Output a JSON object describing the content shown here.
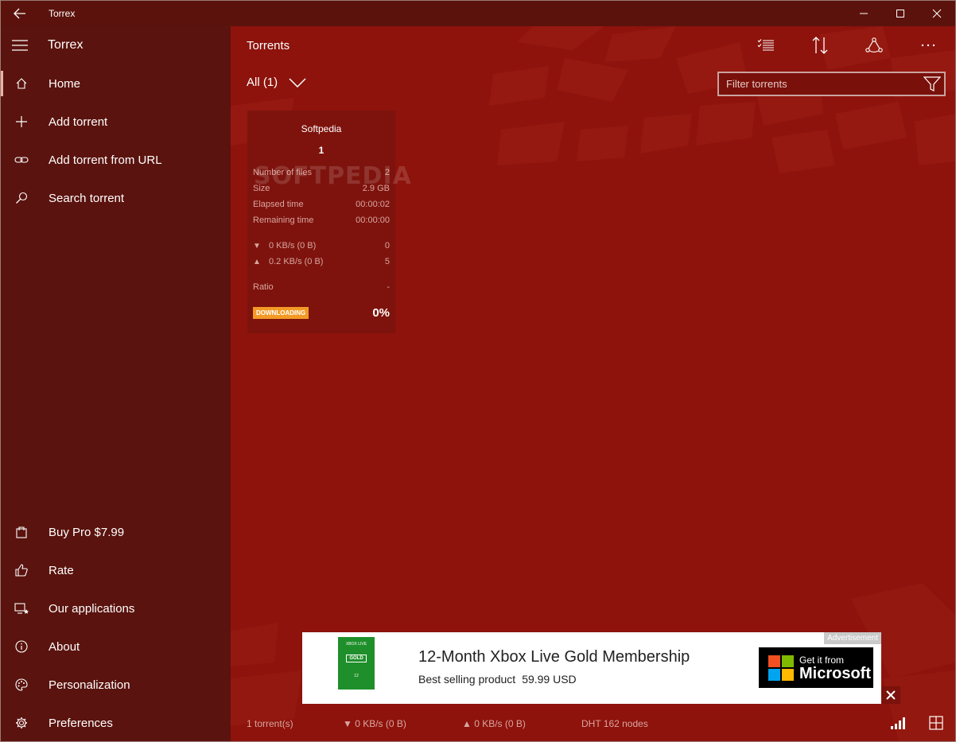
{
  "window": {
    "title": "Torrex"
  },
  "sidebar": {
    "app_name": "Torrex",
    "items": [
      {
        "label": "Home",
        "icon": "home-icon"
      },
      {
        "label": "Add torrent",
        "icon": "plus-icon"
      },
      {
        "label": "Add torrent from URL",
        "icon": "link-icon"
      },
      {
        "label": "Search torrent",
        "icon": "search-icon"
      }
    ],
    "bottom_items": [
      {
        "label": "Buy Pro $7.99",
        "icon": "shopping-bag-icon"
      },
      {
        "label": "Rate",
        "icon": "thumbs-up-icon"
      },
      {
        "label": "Our applications",
        "icon": "applications-icon"
      },
      {
        "label": "About",
        "icon": "info-icon"
      },
      {
        "label": "Personalization",
        "icon": "palette-icon"
      },
      {
        "label": "Preferences",
        "icon": "gear-icon"
      }
    ]
  },
  "main": {
    "title": "Torrents",
    "filter_label": "All (1)",
    "search_placeholder": "Filter torrents"
  },
  "torrent": {
    "name": "Softpedia",
    "index": "1",
    "stats": [
      {
        "label": "Number of files",
        "value": "2"
      },
      {
        "label": "Size",
        "value": "2.9 GB"
      },
      {
        "label": "Elapsed time",
        "value": "00:00:02"
      },
      {
        "label": "Remaining time",
        "value": "00:00:00"
      }
    ],
    "download": {
      "arrow": "▼",
      "speed": "0 KB/s (0 B)",
      "peers": "0"
    },
    "upload": {
      "arrow": "▲",
      "speed": "0.2 KB/s (0 B)",
      "peers": "5"
    },
    "ratio_label": "Ratio",
    "ratio_value": "-",
    "status_badge": "DOWNLOADING",
    "progress": "0%"
  },
  "watermark": "SOFTPEDIA",
  "ad": {
    "tag": "Advertisement",
    "headline": "12-Month Xbox Live Gold Membership",
    "subtitle": "Best selling product",
    "price": "59.99 USD",
    "product_line1": "XBOX LIVE",
    "product_line2": "GOLD",
    "product_line3": "12",
    "cta_small": "Get it from",
    "cta_big": "Microsoft"
  },
  "status": {
    "torrents": "1 torrent(s)",
    "down": "▼ 0 KB/s (0 B)",
    "up": "▲ 0 KB/s (0 B)",
    "dht": "DHT 162 nodes"
  },
  "colors": {
    "sidebar": "#5a130e",
    "main": "#8d130c",
    "titlebar": "#5c120c",
    "badge": "#f39a26"
  }
}
